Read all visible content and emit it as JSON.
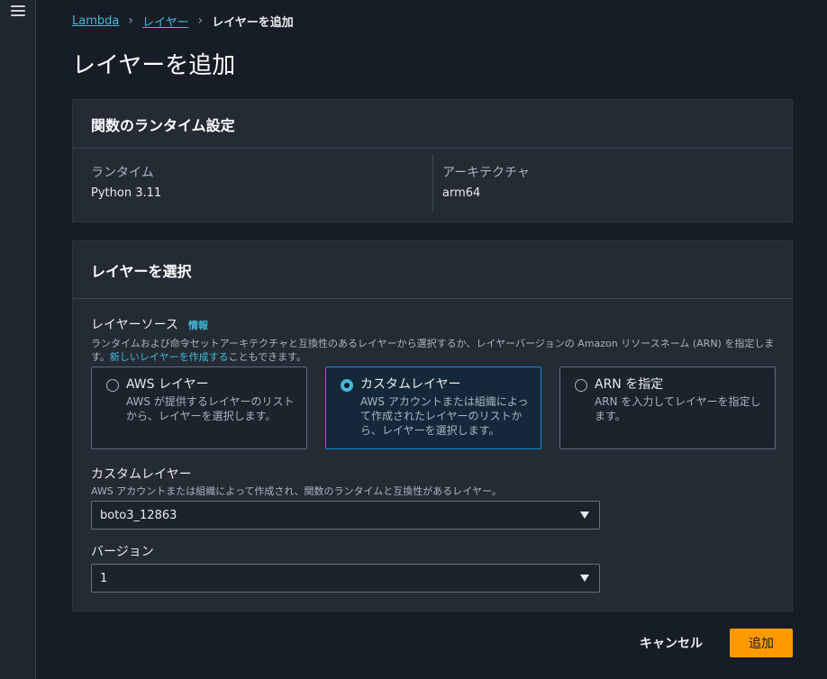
{
  "nav": {
    "menu_icon": "hamburger-menu-icon"
  },
  "breadcrumb": {
    "items": [
      "Lambda",
      "レイヤー"
    ],
    "current": "レイヤーを追加",
    "separator_icon": "chevron-right-icon"
  },
  "page": {
    "title": "レイヤーを追加"
  },
  "runtime_settings": {
    "heading": "関数のランタイム設定",
    "runtime_label": "ランタイム",
    "runtime_value": "Python 3.11",
    "arch_label": "アーキテクチャ",
    "arch_value": "arm64"
  },
  "layer_select": {
    "heading": "レイヤーを選択",
    "source_label": "レイヤーソース",
    "info_link": "情報",
    "description_part1": "ランタイムおよび命令セットアーキテクチャと互換性のあるレイヤーから選択するか、レイヤーバージョンの Amazon リソースネーム (ARN) を指定します。",
    "description_link": "新しいレイヤーを作成する",
    "description_part2": "こともできます。",
    "options": [
      {
        "title": "AWS レイヤー",
        "desc": "AWS が提供するレイヤーのリストから、レイヤーを選択します。",
        "selected": false
      },
      {
        "title": "カスタムレイヤー",
        "desc": "AWS アカウントまたは組織によって作成されたレイヤーのリストから、レイヤーを選択します。",
        "selected": true
      },
      {
        "title": "ARN を指定",
        "desc": "ARN を入力してレイヤーを指定します。",
        "selected": false
      }
    ],
    "custom_layer": {
      "label": "カスタムレイヤー",
      "desc": "AWS アカウントまたは組織によって作成され、関数のランタイムと互換性があるレイヤー。",
      "value": "boto3_12863"
    },
    "version": {
      "label": "バージョン",
      "value": "1"
    },
    "dropdown_icon": "caret-down-icon"
  },
  "actions": {
    "cancel": "キャンセル",
    "add": "追加"
  },
  "colors": {
    "accent": "#44b9d6",
    "primary_button": "#ff9900",
    "selected_border": "#0f8fd1"
  }
}
